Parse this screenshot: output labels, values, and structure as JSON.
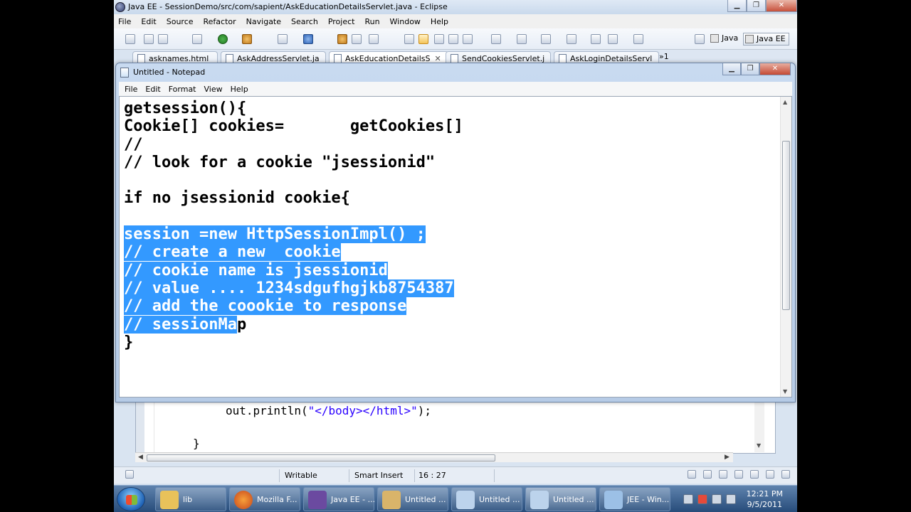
{
  "eclipse": {
    "title": "Java EE - SessionDemo/src/com/sapient/AskEducationDetailsServlet.java - Eclipse",
    "window_controls": {
      "minimize": "▁",
      "maximize": "❐",
      "close": "✕"
    },
    "menu": [
      "File",
      "Edit",
      "Source",
      "Refactor",
      "Navigate",
      "Search",
      "Project",
      "Run",
      "Window",
      "Help"
    ],
    "perspectives": [
      "Java",
      "Java EE"
    ],
    "tabs": [
      {
        "label": "asknames.html"
      },
      {
        "label": "AskAddressServlet.ja"
      },
      {
        "label": "AskEducationDetailsS"
      },
      {
        "label": "SendCookiesServlet.j"
      },
      {
        "label": "AskLoginDetailsServl"
      }
    ],
    "tab_overflow": "»1",
    "code": {
      "line1_prefix": "out.println(",
      "line1_string": "\"</body></html>\"",
      "line1_suffix": ");",
      "line2": "}"
    },
    "status": {
      "writable": "Writable",
      "insert_mode": "Smart Insert",
      "position": "16 : 27"
    }
  },
  "notepad": {
    "title": "Untitled - Notepad",
    "window_controls": {
      "minimize": "▁",
      "maximize": "❐",
      "close": "✕"
    },
    "menu": [
      "File",
      "Edit",
      "Format",
      "View",
      "Help"
    ],
    "lines": [
      "getsession(){",
      "Cookie[] cookies=       getCookies[]",
      "//",
      "// look for a cookie \"jsessionid\"",
      "",
      "if no jsessionid cookie{",
      "",
      "session =new HttpSessionImpl() ;",
      "// create a new  cookie",
      "// cookie name is jsessionid",
      "// value .... 1234sdgufhgjkb8754387",
      "// add the coookie to response",
      "// sessionMa",
      "p",
      "}"
    ]
  },
  "taskbar": {
    "items": [
      {
        "label": "lib",
        "color": "#e8c25a"
      },
      {
        "label": "Mozilla F...",
        "color": "#e0702a"
      },
      {
        "label": "Java EE - ...",
        "color": "#6b4aa0"
      },
      {
        "label": "Untitled ...",
        "color": "#d9b46a"
      },
      {
        "label": "Untitled ...",
        "color": "#bcd3ec"
      },
      {
        "label": "Untitled ...",
        "color": "#bcd3ec"
      },
      {
        "label": "JEE - Win...",
        "color": "#9cc0e6"
      }
    ],
    "time": "12:21 PM",
    "date": "9/5/2011"
  }
}
